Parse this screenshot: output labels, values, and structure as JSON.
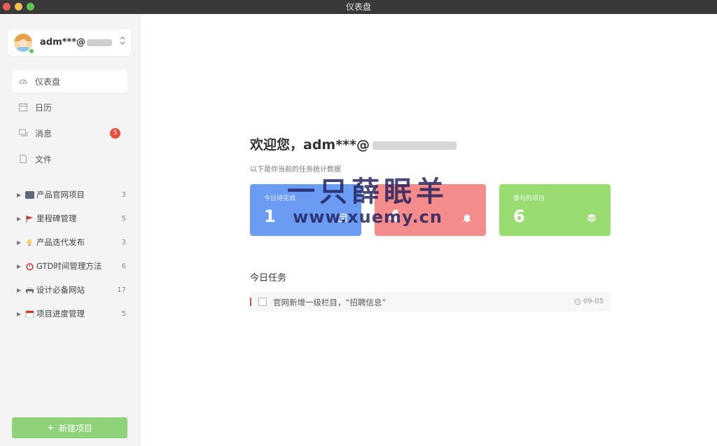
{
  "window": {
    "title": "仪表盘",
    "lights": [
      "#ec5f57",
      "#f4bf4f",
      "#5ec54e"
    ]
  },
  "user": {
    "name": "adm***@",
    "avatar": "avatar-icon",
    "status": "online"
  },
  "nav": [
    {
      "label": "仪表盘",
      "icon": "dashboard-icon",
      "active": true
    },
    {
      "label": "日历",
      "icon": "calendar-icon"
    },
    {
      "label": "消息",
      "icon": "message-icon",
      "badge": "5"
    },
    {
      "label": "文件",
      "icon": "file-icon"
    }
  ],
  "projects": [
    {
      "name": "产品官网项目",
      "count": "3",
      "icon": "computer-icon"
    },
    {
      "name": "里程碑管理",
      "count": "5",
      "icon": "flag-icon"
    },
    {
      "name": "产品迭代发布",
      "count": "3",
      "icon": "bulb-icon"
    },
    {
      "name": "GTD时间管理方法",
      "count": "6",
      "icon": "alarm-clock-icon"
    },
    {
      "name": "设计必备网站",
      "count": "17",
      "icon": "printer-icon"
    },
    {
      "name": "项目进度管理",
      "count": "5",
      "icon": "calendar-icon"
    }
  ],
  "new_project": {
    "label": "新建项目",
    "icon": "plus-icon"
  },
  "main": {
    "welcome": "欢迎您，adm***@",
    "subtitle": "以下是你当前的任务统计数据",
    "cards": [
      {
        "label": "今日待完成",
        "value": "1",
        "color": "#6b9cf4",
        "icon": "calendar-icon"
      },
      {
        "label": "",
        "value": "4",
        "color": "#f58c8c",
        "icon": "bell-icon"
      },
      {
        "label": "参与的项目",
        "value": "6",
        "color": "#98dc72",
        "icon": "layers-icon"
      }
    ],
    "today_tasks_title": "今日任务",
    "tasks": [
      {
        "text": "官网新增一级栏目，“招聘信息”",
        "date": "09-05",
        "priority_color": "#e94e3c"
      }
    ]
  },
  "watermark": {
    "line1": "一只薛眠羊",
    "line2": "www.xuemy.cn"
  }
}
